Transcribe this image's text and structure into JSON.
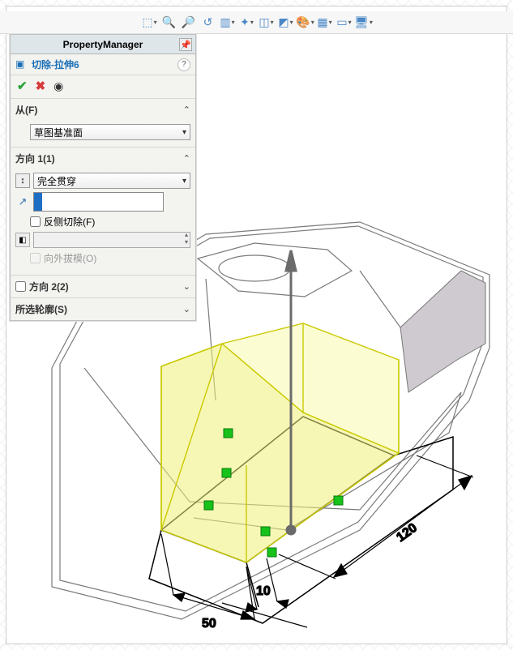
{
  "header": {
    "title": "PropertyManager"
  },
  "feature": {
    "name": "切除-拉伸6"
  },
  "sections": {
    "from": {
      "label": "从(F)",
      "select": "草图基准面"
    },
    "dir1": {
      "label": "方向 1(1)",
      "end_condition": "完全贯穿",
      "flip_side_label": "反侧切除(F)",
      "draft_outward_label": "向外拔模(O)",
      "input_value": ""
    },
    "dir2": {
      "label": "方向 2(2)"
    },
    "contour": {
      "label": "所选轮廓(S)"
    }
  },
  "dims": {
    "w": "50",
    "gap": "10",
    "len": "120"
  },
  "toolbar_icons": [
    "orientation-icon",
    "zoom-fit-icon",
    "zoom-area-icon",
    "previous-view-icon",
    "section-view-icon",
    "view-settings-icon",
    "display-style-icon",
    "hide-show-icon",
    "edit-appearance-icon",
    "apply-scene-icon",
    "view-settings2-icon",
    "display-state-icon"
  ]
}
